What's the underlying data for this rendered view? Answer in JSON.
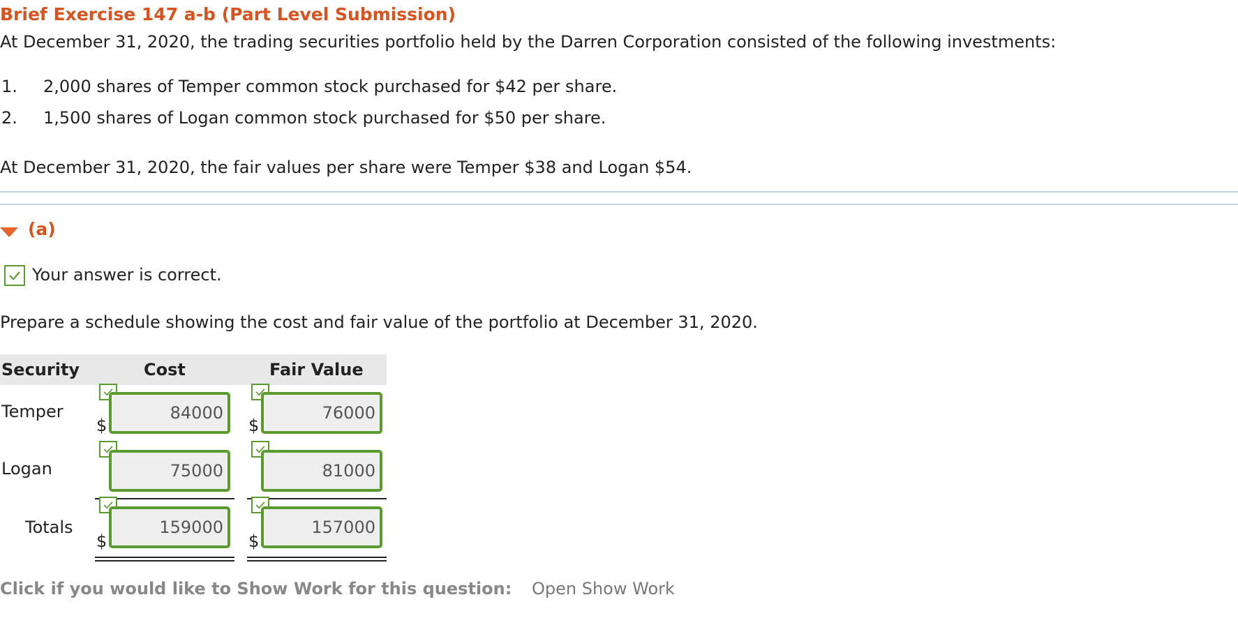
{
  "header": {
    "title": "Brief Exercise 147 a-b (Part Level Submission)"
  },
  "problem": {
    "intro": "At December 31, 2020, the trading securities portfolio held by the Darren Corporation consisted of the following investments:",
    "items": [
      {
        "num": "1.",
        "text": "2,000 shares of Temper common stock purchased for $42 per share."
      },
      {
        "num": "2.",
        "text": "1,500 shares of Logan common stock purchased for $50 per share."
      }
    ],
    "fair_values": "At December 31, 2020, the fair values per share were Temper $38 and Logan $54."
  },
  "part_a": {
    "label": "(a)",
    "status_text": "Your answer is correct.",
    "instruction": "Prepare a schedule showing the cost and fair value of the portfolio at December 31, 2020.",
    "table": {
      "headers": {
        "security": "Security",
        "cost": "Cost",
        "fair_value": "Fair Value"
      },
      "currency_symbol": "$",
      "rows": [
        {
          "security": "Temper",
          "cost": "84000",
          "fair_value": "76000"
        },
        {
          "security": "Logan",
          "cost": "75000",
          "fair_value": "81000"
        }
      ],
      "totals": {
        "label": "Totals",
        "cost": "159000",
        "fair_value": "157000"
      }
    }
  },
  "footer": {
    "label": "Click if you would like to Show Work for this question:",
    "link": "Open Show Work"
  },
  "colors": {
    "accent": "#d9531e",
    "correct_green": "#5a9a2e",
    "caret": "#e8622c"
  }
}
